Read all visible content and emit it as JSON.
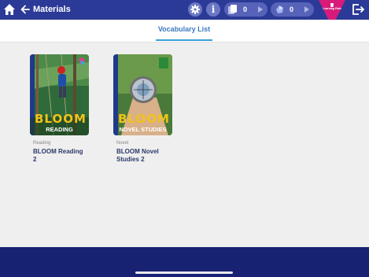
{
  "header": {
    "title": "Materials",
    "counters": [
      {
        "icon": "cards-icon",
        "value": "0"
      },
      {
        "icon": "gem-icon",
        "value": "0"
      }
    ],
    "learning_path_label": "Learning Path"
  },
  "tabs": [
    {
      "label": "Vocabulary List",
      "active": true
    }
  ],
  "books": [
    {
      "category": "Reading",
      "name": "BLOOM Reading 2",
      "cover_label": "READING",
      "cover_brand": "BLOOM"
    },
    {
      "category": "Novel",
      "name": "BLOOM Novel Studies 2",
      "cover_label": "NOVEL STUDIES",
      "cover_brand": "BLOOM"
    }
  ],
  "colors": {
    "topbar": "#2b3a97",
    "bottombar": "#182272",
    "accent": "#3aa0d8",
    "learning_path": "#d81b7a"
  }
}
